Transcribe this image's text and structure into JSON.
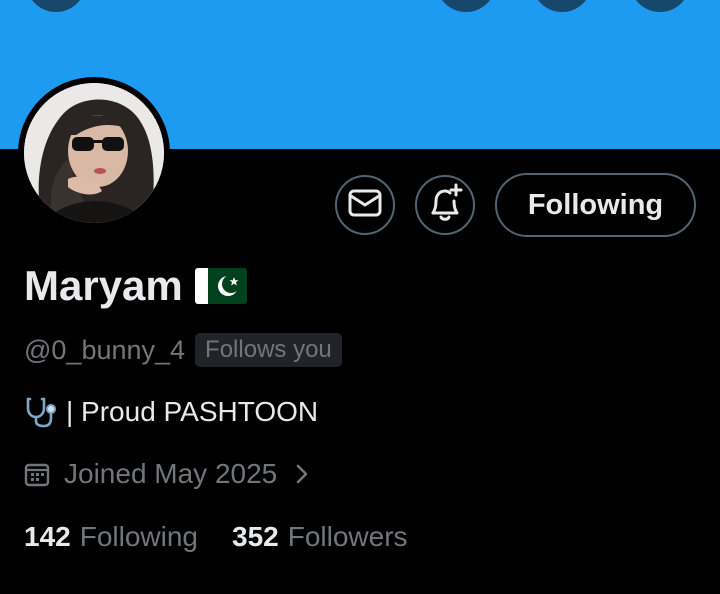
{
  "profile": {
    "name": "Maryam",
    "handle": "@0_bunny_4",
    "follows_you": "Follows you",
    "bio_text": "| Proud PASHTOON",
    "joined": "Joined May 2025"
  },
  "actions": {
    "following_label": "Following"
  },
  "stats": {
    "following_count": "142",
    "following_label": "Following",
    "followers_count": "352",
    "followers_label": "Followers"
  },
  "colors": {
    "banner": "#1d9bf0",
    "background": "#000000",
    "primary_text": "#e7e9ea",
    "secondary_text": "#71767b",
    "button_border": "#536471"
  },
  "icons": {
    "message": "envelope-icon",
    "notify": "bell-plus-icon",
    "bio_emoji": "stethoscope-icon",
    "flag": "pakistan-flag-icon",
    "joined": "calendar-icon",
    "chevron": "chevron-right-icon"
  }
}
